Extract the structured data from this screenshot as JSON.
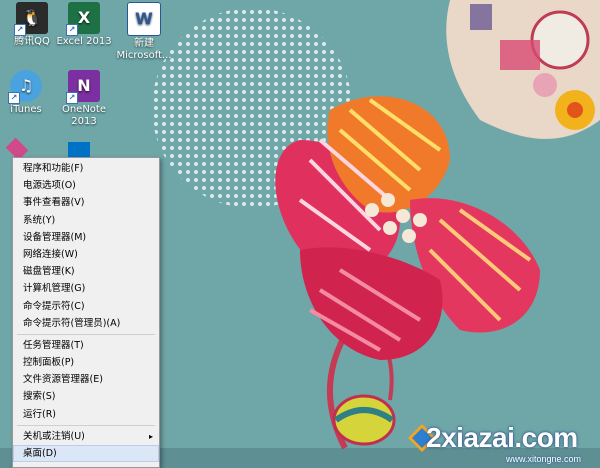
{
  "desktop_icons": [
    {
      "label": "腾讯QQ",
      "icon": "qq-penguin-icon",
      "color": "#2b2b2b"
    },
    {
      "label": "Excel 2013",
      "icon": "excel-icon",
      "color": "#1e7145"
    },
    {
      "label": "新建 Microsoft...",
      "icon": "word-document-icon",
      "color": "#2b5797"
    },
    {
      "label": "iTunes",
      "icon": "itunes-icon",
      "color": "#4aa3df"
    },
    {
      "label": "OneNote 2013",
      "icon": "onenote-icon",
      "color": "#7b2fa0"
    }
  ],
  "menu": {
    "items": [
      {
        "label": "程序和功能(F)"
      },
      {
        "label": "电源选项(O)"
      },
      {
        "label": "事件查看器(V)"
      },
      {
        "label": "系统(Y)"
      },
      {
        "label": "设备管理器(M)"
      },
      {
        "label": "网络连接(W)"
      },
      {
        "label": "磁盘管理(K)"
      },
      {
        "label": "计算机管理(G)"
      },
      {
        "label": "命令提示符(C)"
      },
      {
        "label": "命令提示符(管理员)(A)"
      },
      {
        "label": "任务管理器(T)"
      },
      {
        "label": "控制面板(P)"
      },
      {
        "label": "文件资源管理器(E)"
      },
      {
        "label": "搜索(S)"
      },
      {
        "label": "运行(R)"
      },
      {
        "label": "关机或注销(U)"
      },
      {
        "label": "桌面(D)"
      }
    ],
    "highlight_color": "#dbe7f6"
  },
  "watermark": {
    "text": "2xiazai.com",
    "url": "www.xitongne.com"
  }
}
